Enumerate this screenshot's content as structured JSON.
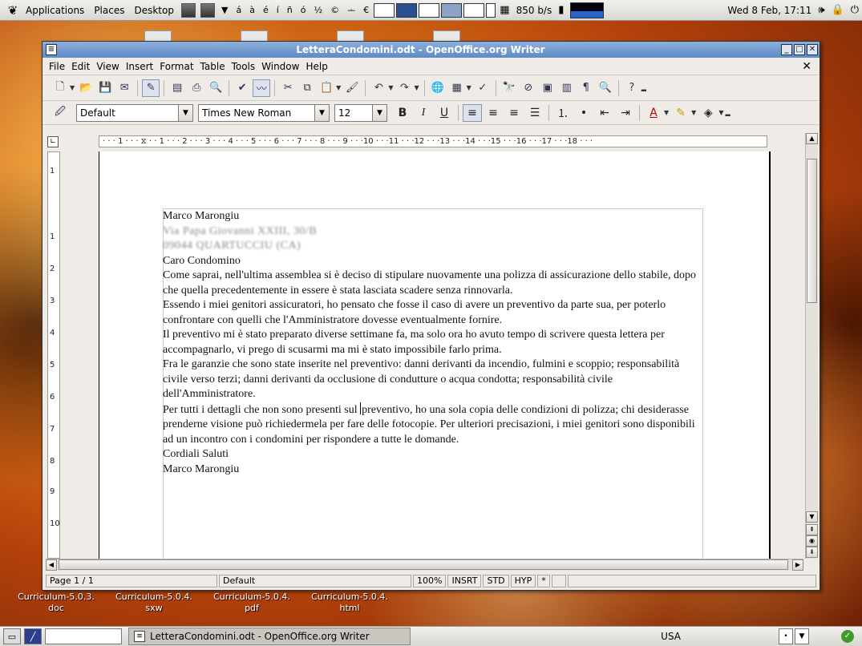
{
  "top_panel": {
    "menus": [
      "Applications",
      "Places",
      "Desktop"
    ],
    "chars": [
      "á",
      "à",
      "é",
      "í",
      "ñ",
      "ó",
      "½",
      "©",
      "ᅩ",
      "€"
    ],
    "net_speed": "850 b/s",
    "clock": "Wed 8 Feb, 17:11"
  },
  "desktop_icons": [
    {
      "label": "Curriculum-5.0.3.\ndoc"
    },
    {
      "label": "Curriculum-5.0.4.\nsxw"
    },
    {
      "label": "Curriculum-5.0.4.\npdf"
    },
    {
      "label": "Curriculum-5.0.4.\nhtml"
    }
  ],
  "window": {
    "title": "LetteraCondomini.odt - OpenOffice.org Writer",
    "menu": [
      "File",
      "Edit",
      "View",
      "Insert",
      "Format",
      "Table",
      "Tools",
      "Window",
      "Help"
    ],
    "close_doc": "✕"
  },
  "format_bar": {
    "style": "Default",
    "font": "Times New Roman",
    "size": "12"
  },
  "ruler_text": "· · · 1 · · · ⧖ · · 1 · · · 2 · · · 3 · · · 4 · · · 5 · · · 6 · · · 7 · · · 8 · · · 9 · · ·10 · · ·11 · · ·12 · · ·13 · · ·14 · · ·15 · · ·16 · · ·17 · · ·18 · · ·",
  "vruler_numbers": [
    "1",
    "1",
    "2",
    "3",
    "4",
    "5",
    "6",
    "7",
    "8",
    "9",
    "10"
  ],
  "document": {
    "sender_name": "Marco Marongiu",
    "blurred_line1": "Via Papa Giovanni XXIII, 30/B",
    "blurred_line2": "09044 QUARTUCCIU (CA)",
    "greeting": "Caro Condomino",
    "para1": "Come saprai, nell'ultima assemblea si è deciso di stipulare nuovamente una polizza di assicurazione dello stabile, dopo che quella precedentemente in essere è stata lasciata scadere senza rinnovarla.",
    "para2": "Essendo i miei genitori assicuratori, ho pensato che fosse il caso di avere un preventivo da parte sua, per poterlo confrontare con quelli che l'Amministratore dovesse eventualmente fornire.",
    "para3": "Il preventivo mi è stato preparato diverse settimane fa, ma solo ora ho avuto tempo di scrivere questa lettera per accompagnarlo, vi prego di scusarmi ma mi è stato impossibile farlo prima.",
    "para4": "Fra le garanzie che sono state inserite nel preventivo: danni derivanti da incendio, fulmini e scoppio; responsabilità civile verso terzi; danni derivanti da occlusione di condutture o acqua condotta; responsabilità civile dell'Amministratore.",
    "para5_before": "Per tutti i dettagli che non sono presenti sul ",
    "para5_after": "preventivo, ho una sola copia delle condizioni di polizza; chi desiderasse prenderne visione può richiedermela per fare delle fotocopie. Per ulteriori precisazioni, i miei genitori sono disponibili ad un incontro con i condomini per rispondere a tutte le domande.",
    "closing": "Cordiali Saluti",
    "signature": "Marco Marongiu"
  },
  "statusbar": {
    "page": "Page 1 / 1",
    "style": "Default",
    "zoom": "100%",
    "insert": "INSRT",
    "selection": "STD",
    "hyphen": "HYP",
    "modified": "*"
  },
  "taskbar": {
    "task": "LetteraCondomini.odt - OpenOffice.org Writer",
    "keyboard": "USA"
  }
}
